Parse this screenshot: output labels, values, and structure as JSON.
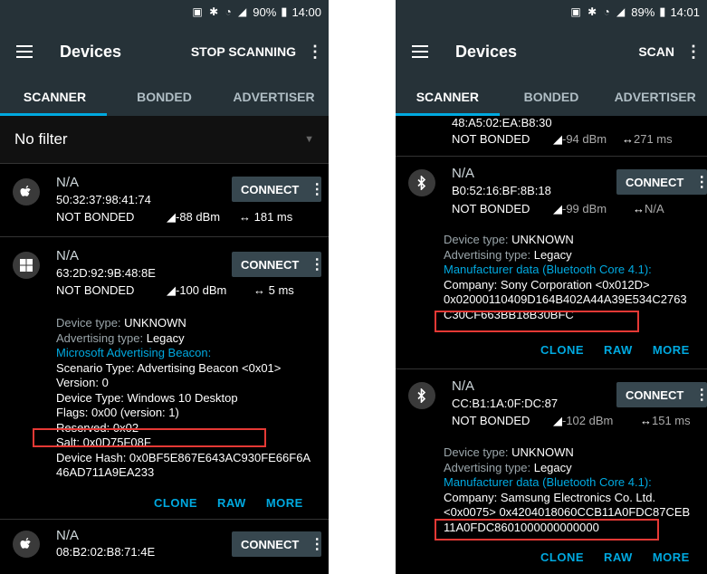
{
  "left": {
    "status": {
      "battery": "90%",
      "time": "14:00"
    },
    "appbar": {
      "title": "Devices",
      "action": "STOP SCANNING"
    },
    "tabs": [
      "SCANNER",
      "BONDED",
      "ADVERTISER"
    ],
    "filter": "No filter",
    "devices": [
      {
        "name": "N/A",
        "mac": "50:32:37:98:41:74",
        "bond": "NOT BONDED",
        "rssi": "-88 dBm",
        "interval": "181 ms",
        "connect": "CONNECT"
      },
      {
        "name": "N/A",
        "mac": "63:2D:92:9B:48:8E",
        "bond": "NOT BONDED",
        "rssi": "-100 dBm",
        "interval": "5 ms",
        "connect": "CONNECT",
        "details": {
          "device_type_label": "Device type: ",
          "device_type": "UNKNOWN",
          "adv_type_label": "Advertising type: ",
          "adv_type": "Legacy",
          "beacon": "Microsoft Advertising Beacon:",
          "scenario": "Scenario Type: Advertising Beacon <0x01>",
          "version": "Version: 0",
          "dtype": "Device Type: Windows 10 Desktop",
          "flags": "Flags: 0x00 (version: 1)",
          "reserved": "Reserved: 0x02",
          "salt": "Salt: 0x0D75F08F",
          "hash1": "Device Hash: 0x0BF5E867E643AC930FE66F6A",
          "hash2": "46AD711A9EA233"
        },
        "actions": [
          "CLONE",
          "RAW",
          "MORE"
        ]
      },
      {
        "name": "N/A",
        "mac": "08:B2:02:B8:71:4E",
        "connect": "CONNECT"
      }
    ]
  },
  "right": {
    "status": {
      "battery": "89%",
      "time": "14:01"
    },
    "appbar": {
      "title": "Devices",
      "action": "SCAN"
    },
    "tabs": [
      "SCANNER",
      "BONDED",
      "ADVERTISER"
    ],
    "partial": {
      "mac": "48:A5:02:EA:B8:30",
      "bond": "NOT BONDED",
      "rssi": "-94 dBm",
      "interval": "271 ms"
    },
    "devices": [
      {
        "name": "N/A",
        "mac": "B0:52:16:BF:8B:18",
        "bond": "NOT BONDED",
        "rssi": "-99 dBm",
        "interval": "N/A",
        "connect": "CONNECT",
        "details": {
          "device_type_label": "Device type: ",
          "device_type": "UNKNOWN",
          "adv_type_label": "Advertising type: ",
          "adv_type": "Legacy",
          "manuf": "Manufacturer data (Bluetooth Core 4.1):",
          "company": "Company: Sony Corporation <0x012D>",
          "data1": "0x02000110409D164B402A44A39E534C2763",
          "data2": "C30CF663BB18B30BFC"
        },
        "actions": [
          "CLONE",
          "RAW",
          "MORE"
        ]
      },
      {
        "name": "N/A",
        "mac": "CC:B1:1A:0F:DC:87",
        "bond": "NOT BONDED",
        "rssi": "-102 dBm",
        "interval": "151 ms",
        "connect": "CONNECT",
        "details": {
          "device_type_label": "Device type: ",
          "device_type": "UNKNOWN",
          "adv_type_label": "Advertising type: ",
          "adv_type": "Legacy",
          "manuf": "Manufacturer data (Bluetooth Core 4.1):",
          "company": "Company: Samsung Electronics Co. Ltd.",
          "data1": "<0x0075> 0x4204018060CCB11A0FDC87CEB",
          "data2": "11A0FDC8601000000000000"
        },
        "actions": [
          "CLONE",
          "RAW",
          "MORE"
        ]
      }
    ]
  },
  "icons": {
    "apple": "apple-icon",
    "windows": "windows-icon",
    "bluetooth": "bluetooth-icon"
  }
}
